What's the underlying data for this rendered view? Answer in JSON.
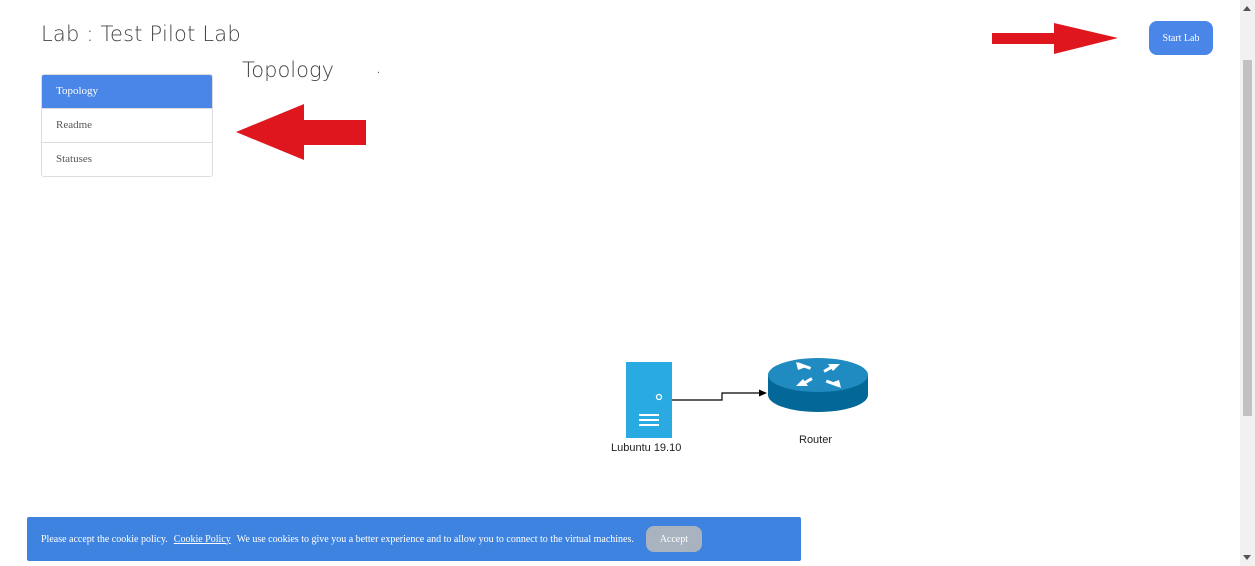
{
  "header": {
    "title": "Lab : Test Pilot Lab",
    "start_button_label": "Start Lab"
  },
  "sidebar": {
    "items": [
      {
        "label": "Topology",
        "active": true
      },
      {
        "label": "Readme",
        "active": false
      },
      {
        "label": "Statuses",
        "active": false
      }
    ]
  },
  "main": {
    "section_title": "Topology",
    "section_suffix": ".",
    "topology": {
      "nodes": [
        {
          "label": "Lubuntu 19.10",
          "icon": "server-icon"
        },
        {
          "label": "Router",
          "icon": "router-icon"
        }
      ]
    }
  },
  "cookie_banner": {
    "text_before": "Please accept the cookie policy.",
    "link_label": "Cookie Policy",
    "text_after": "We use cookies to give you a better experience and to allow you to connect to the virtual machines.",
    "accept_label": "Accept"
  },
  "colors": {
    "accent": "#4a86e8",
    "annotation_arrow": "#e0161e",
    "server": "#29abe2",
    "router": "#036897"
  }
}
